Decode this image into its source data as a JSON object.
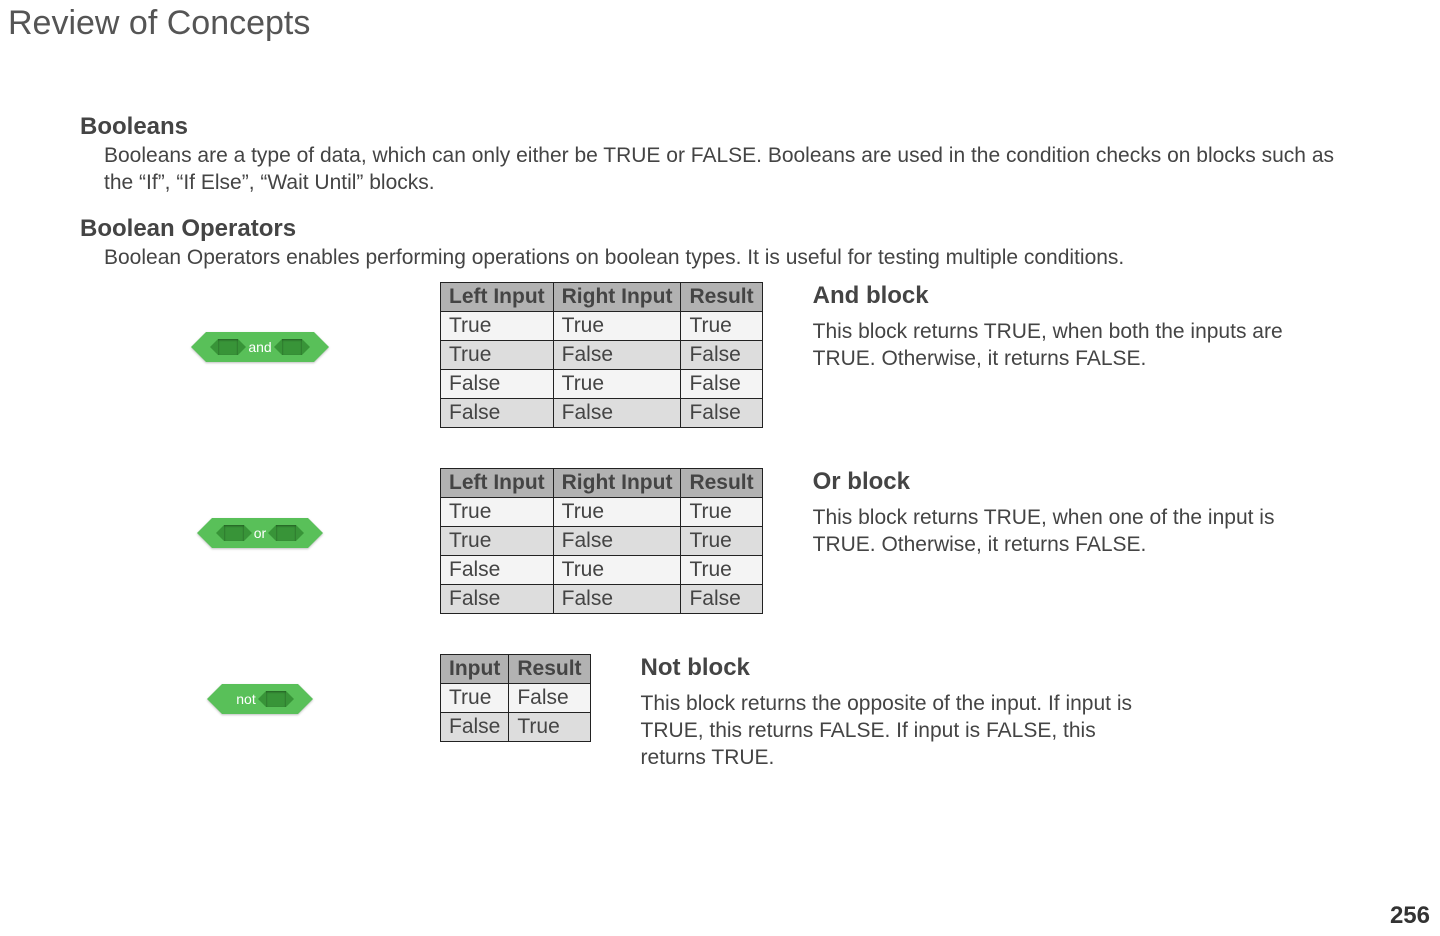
{
  "page_title": "Review of Concepts",
  "page_number": "256",
  "booleans": {
    "heading": "Booleans",
    "body": "Booleans are a type of data, which can only either be TRUE or FALSE. Booleans are used in the condition checks on blocks such as the “If”, “If Else”, “Wait Until” blocks."
  },
  "boolean_operators": {
    "heading": "Boolean Operators",
    "body": "Boolean Operators enables performing operations on boolean types. It is useful for testing multiple conditions."
  },
  "blocks": {
    "and": {
      "label": "and",
      "heading": "And block",
      "desc": "This block returns TRUE, when both the inputs are TRUE. Otherwise, it returns FALSE.",
      "headers": [
        "Left Input",
        "Right Input",
        "Result"
      ],
      "rows": [
        [
          "True",
          "True",
          "True"
        ],
        [
          "True",
          "False",
          "False"
        ],
        [
          "False",
          "True",
          "False"
        ],
        [
          "False",
          "False",
          "False"
        ]
      ]
    },
    "or": {
      "label": "or",
      "heading": "Or block",
      "desc": "This block returns TRUE, when one of the input is TRUE. Otherwise, it returns FALSE.",
      "headers": [
        "Left Input",
        "Right Input",
        "Result"
      ],
      "rows": [
        [
          "True",
          "True",
          "True"
        ],
        [
          "True",
          "False",
          "True"
        ],
        [
          "False",
          "True",
          "True"
        ],
        [
          "False",
          "False",
          "False"
        ]
      ]
    },
    "not": {
      "label": "not",
      "heading": "Not block",
      "desc": "This block returns the opposite of the input. If input is TRUE, this returns FALSE. If input is FALSE, this returns TRUE.",
      "headers": [
        "Input",
        "Result"
      ],
      "rows": [
        [
          "True",
          "False"
        ],
        [
          "False",
          "True"
        ]
      ]
    }
  }
}
